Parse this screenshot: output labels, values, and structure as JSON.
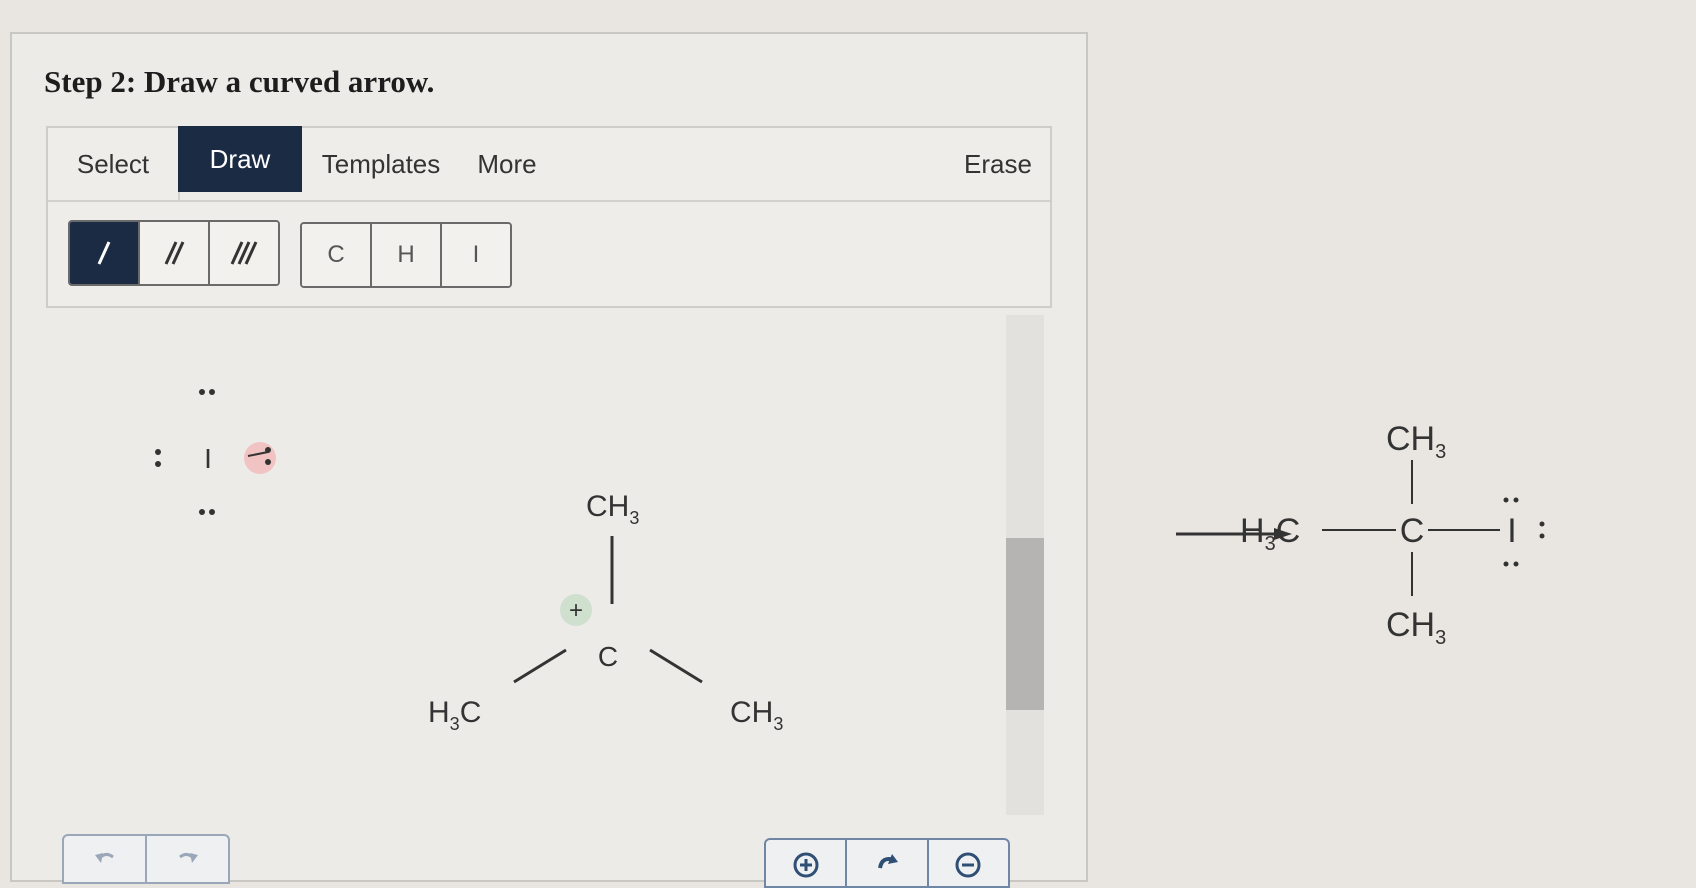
{
  "step": {
    "title": "Step 2: Draw a curved arrow."
  },
  "tabs": {
    "select": "Select",
    "draw": "Draw",
    "templates": "Templates",
    "more": "More",
    "erase": "Erase"
  },
  "atoms": [
    "C",
    "H",
    "I"
  ],
  "molecule": {
    "iodide_symbol": "I",
    "top_group": "CH",
    "top_sub": "3",
    "center_atom": "C",
    "charge": "+",
    "left_group": "H",
    "left_sub": "3",
    "left_tail": "C",
    "right_group": "CH",
    "right_sub": "3"
  },
  "product": {
    "top_group": "CH",
    "top_sub": "3",
    "left_group": "H",
    "left_sub": "3",
    "left_tail": "C",
    "center_atom": "C",
    "iodine": "I",
    "bottom_group": "CH",
    "bottom_sub": "3"
  },
  "colors": {
    "toolbar_active": "#1c2b44",
    "panel_bg": "#ecebe8",
    "charge_highlight": "#cfe0cf",
    "lone_pair_highlight": "#f2c3c3"
  }
}
